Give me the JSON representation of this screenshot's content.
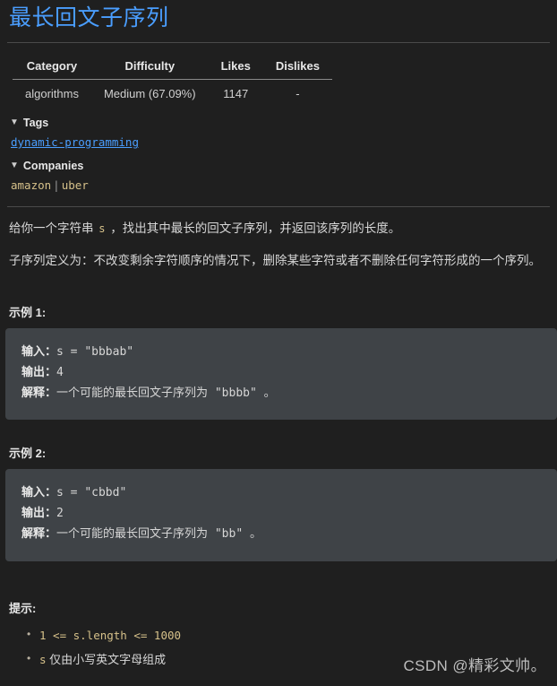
{
  "title": "最长回文子序列",
  "meta_table": {
    "headers": [
      "Category",
      "Difficulty",
      "Likes",
      "Dislikes"
    ],
    "rows": [
      [
        "algorithms",
        "Medium (67.09%)",
        "1147",
        "-"
      ]
    ]
  },
  "tags": {
    "heading": "Tags",
    "toggle_icon": "▼",
    "items": [
      "dynamic-programming"
    ]
  },
  "companies": {
    "heading": "Companies",
    "toggle_icon": "▼",
    "items": [
      "amazon",
      "uber"
    ],
    "separator": "|"
  },
  "description": {
    "para1_before": "给你一个字符串 ",
    "para1_code": "s",
    "para1_after": " ，找出其中最长的回文子序列，并返回该序列的长度。",
    "para2": "子序列定义为：不改变剩余字符顺序的情况下，删除某些字符或者不删除任何字符形成的一个序列。"
  },
  "examples": [
    {
      "heading": "示例 1:",
      "input_label": "输入：",
      "input_value": "s = \"bbbab\"",
      "output_label": "输出：",
      "output_value": "4",
      "explain_label": "解释：",
      "explain_value": "一个可能的最长回文子序列为 \"bbbb\" 。"
    },
    {
      "heading": "示例 2:",
      "input_label": "输入：",
      "input_value": "s = \"cbbd\"",
      "output_label": "输出：",
      "output_value": "2",
      "explain_label": "解释：",
      "explain_value": "一个可能的最长回文子序列为 \"bb\" 。"
    }
  ],
  "hints": {
    "heading": "提示:",
    "items": [
      {
        "code": "1 <= s.length <= 1000",
        "text": ""
      },
      {
        "code": "s",
        "text": " 仅由小写英文字母组成"
      }
    ]
  },
  "watermark": "CSDN @精彩文帅。",
  "colors": {
    "background": "#1f1f1f",
    "title": "#4a9eff",
    "code_block_bg": "#3f4347",
    "code_text": "#d6c18a",
    "divider": "#4a4a4a"
  }
}
